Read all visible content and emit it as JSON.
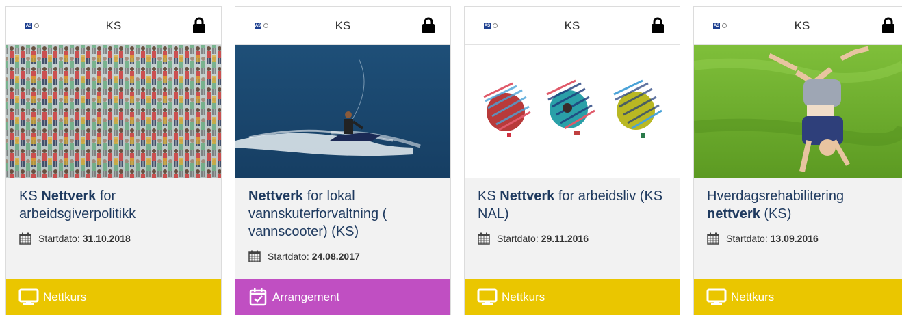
{
  "colors": {
    "title": "#1f3a5f",
    "nettkurs": "#eac600",
    "arrangement": "#c04fc2",
    "body_bg": "#f2f2f2"
  },
  "cards": [
    {
      "provider": "KS",
      "logo_text": "AS",
      "title_pre": "KS ",
      "title_bold": "Nettverk",
      "title_post": " for arbeidsgiverpolitikk",
      "date_label": "Startdato:",
      "date_value": "31.10.2018",
      "type_label": "Nettkurs",
      "type_icon": "monitor-icon"
    },
    {
      "provider": "KS",
      "logo_text": "AS",
      "title_pre": "",
      "title_bold": "Nettverk",
      "title_post": " for lokal vannskuterforvaltning ( vannscooter) (KS)",
      "date_label": "Startdato:",
      "date_value": "24.08.2017",
      "type_label": "Arrangement",
      "type_icon": "calendar-check-icon"
    },
    {
      "provider": "KS",
      "logo_text": "AS",
      "title_pre": "KS ",
      "title_bold": "Nettverk",
      "title_post": " for arbeidsliv (KS NAL)",
      "date_label": "Startdato:",
      "date_value": "29.11.2016",
      "type_label": "Nettkurs",
      "type_icon": "monitor-icon"
    },
    {
      "provider": "KS",
      "logo_text": "AS",
      "title_pre": "Hverdagsrehabilitering ",
      "title_bold": "nettverk",
      "title_post": " (KS)",
      "date_label": "Startdato:",
      "date_value": "13.09.2016",
      "type_label": "Nettkurs",
      "type_icon": "monitor-icon"
    }
  ]
}
